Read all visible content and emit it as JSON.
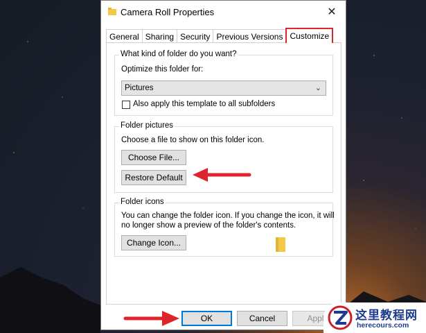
{
  "window": {
    "title": "Camera Roll Properties",
    "close_glyph": "✕"
  },
  "tabs": [
    {
      "label": "General"
    },
    {
      "label": "Sharing"
    },
    {
      "label": "Security"
    },
    {
      "label": "Previous Versions"
    },
    {
      "label": "Customize"
    }
  ],
  "active_tab": "Customize",
  "folder_type": {
    "legend": "What kind of folder do you want?",
    "optimize_label": "Optimize this folder for:",
    "selected": "Pictures",
    "subfolders_label": "Also apply this template to all subfolders",
    "subfolders_checked": false
  },
  "folder_pictures": {
    "legend": "Folder pictures",
    "description": "Choose a file to show on this folder icon.",
    "choose_file_label": "Choose File...",
    "restore_default_label": "Restore Default"
  },
  "folder_icons": {
    "legend": "Folder icons",
    "description_line1": "You can change the folder icon. If you change the icon, it will",
    "description_line2": "no longer show a preview of the folder's contents.",
    "change_icon_label": "Change Icon..."
  },
  "footer": {
    "ok_label": "OK",
    "cancel_label": "Cancel",
    "apply_label": "Apply"
  },
  "watermark": {
    "name": "这里教程网",
    "url": "herecours.com"
  },
  "colors": {
    "annotation_red": "#e0242c",
    "folder_yellow": "#f3c94a",
    "focus_blue": "#0078d7"
  },
  "icons": [
    "folder-icon",
    "close-icon",
    "chevron-down-icon",
    "arrow-left-icon",
    "arrow-right-icon"
  ]
}
